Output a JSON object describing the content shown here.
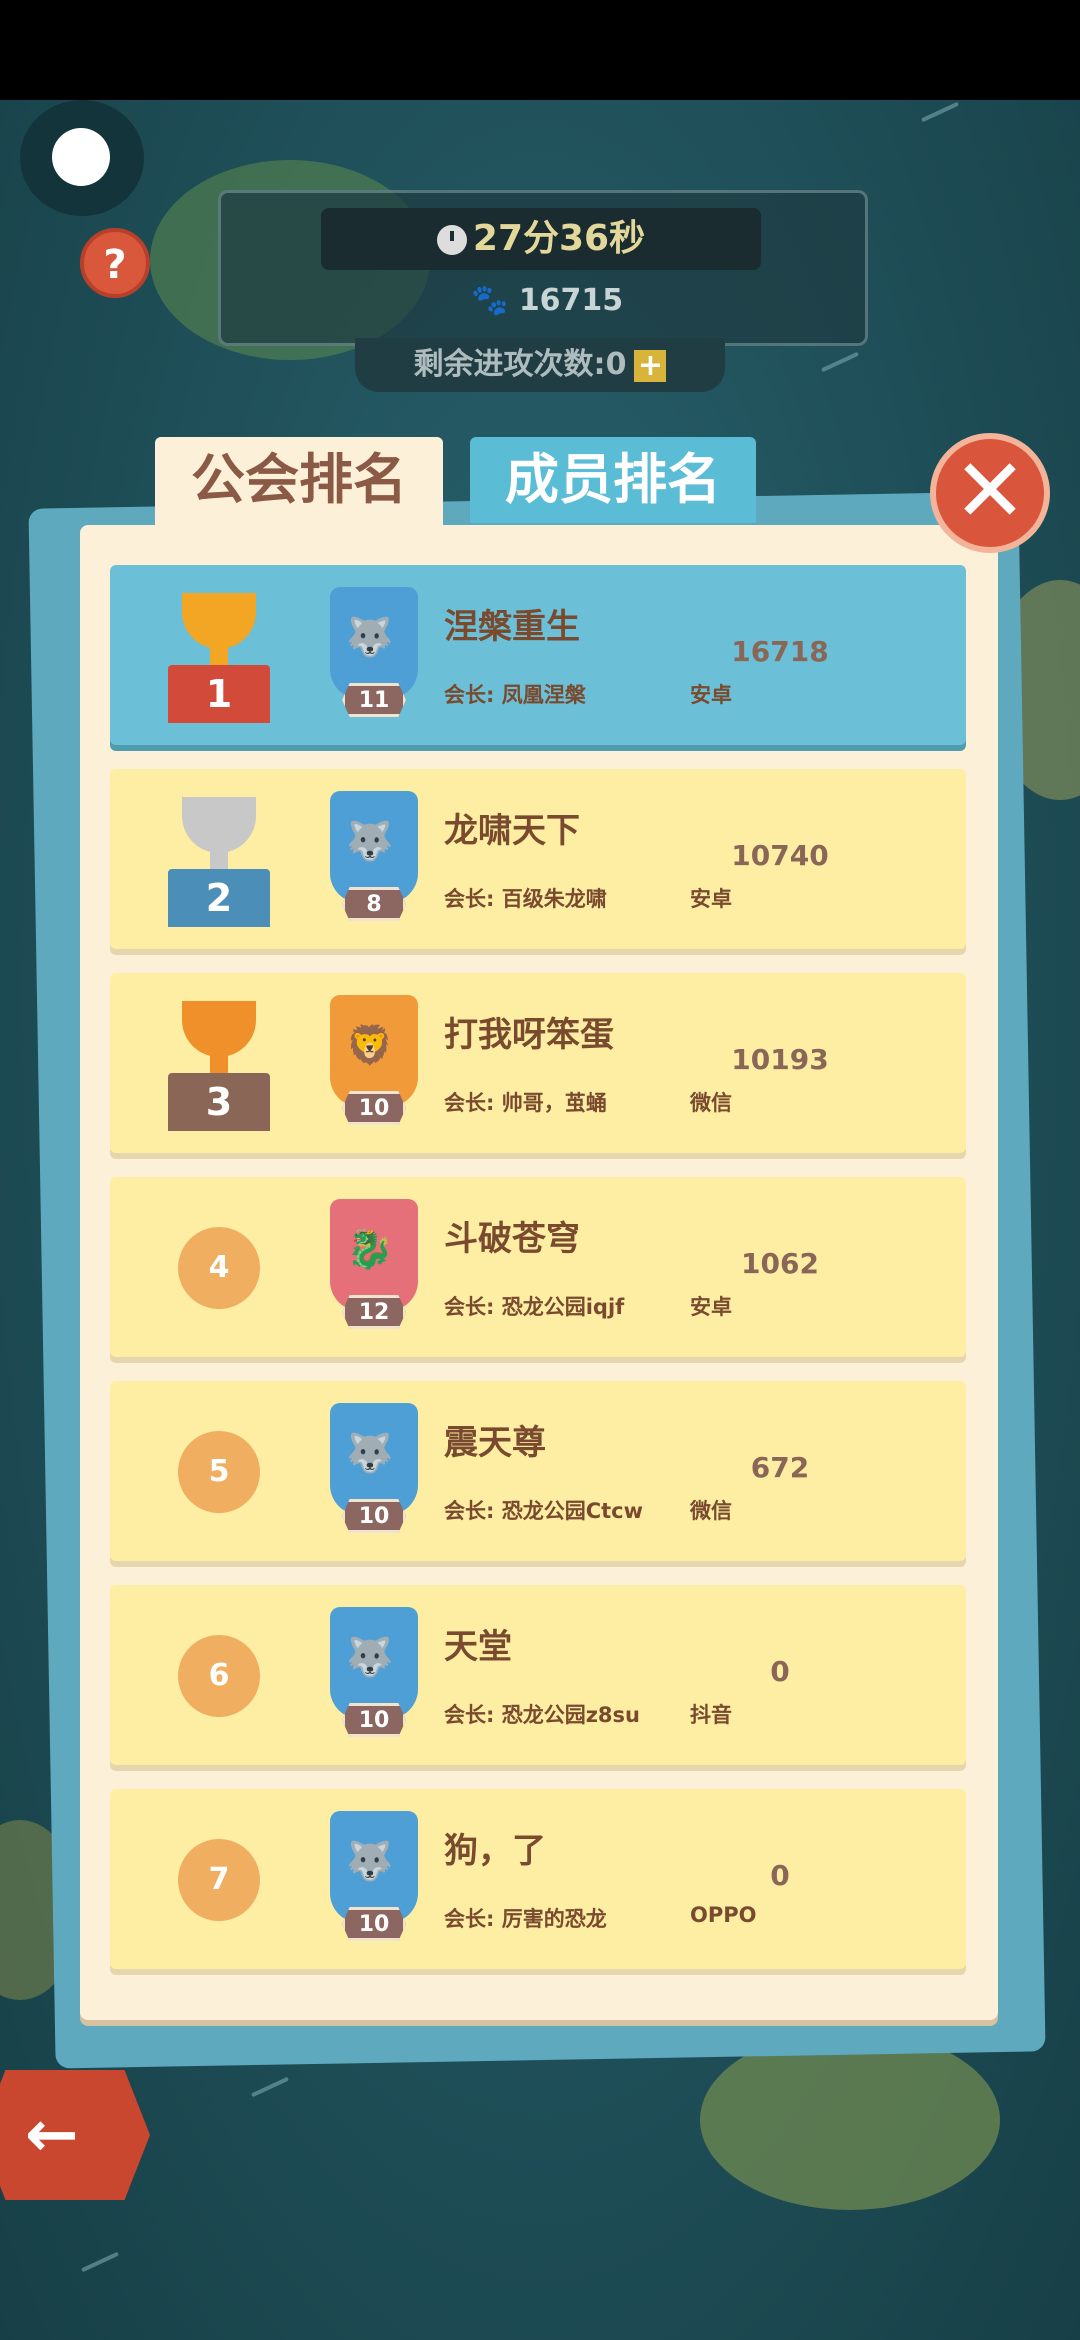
{
  "hud": {
    "timer": "27分36秒",
    "power": "16715",
    "attack_label": "剩余进攻次数:",
    "attack_count": "0",
    "plus": "+",
    "help": "?"
  },
  "tabs": {
    "guild_ranking": "公会排名",
    "member_ranking": "成员排名"
  },
  "close": "✕",
  "back": "←",
  "leader_prefix": "会长:",
  "rows": [
    {
      "rank": "1",
      "name": "涅槃重生",
      "leader": "会长: 凤凰涅槃",
      "platform": "安卓",
      "score": "16718",
      "level": "11",
      "emblem": "wolf",
      "color": "#4d9fd6"
    },
    {
      "rank": "2",
      "name": "龙啸天下",
      "leader": "会长: 百级朱龙啸",
      "platform": "安卓",
      "score": "10740",
      "level": "8",
      "emblem": "wolf",
      "color": "#4d9fd6"
    },
    {
      "rank": "3",
      "name": "打我呀笨蛋",
      "leader": "会长: 帅哥，茧蛹",
      "platform": "微信",
      "score": "10193",
      "level": "10",
      "emblem": "lion",
      "color": "#f09a3a"
    },
    {
      "rank": "4",
      "name": "斗破苍穹",
      "leader": "会长: 恐龙公园iqjf",
      "platform": "安卓",
      "score": "1062",
      "level": "12",
      "emblem": "dragon",
      "color": "#e5707a"
    },
    {
      "rank": "5",
      "name": "震天尊",
      "leader": "会长: 恐龙公园Ctcw",
      "platform": "微信",
      "score": "672",
      "level": "10",
      "emblem": "wolf",
      "color": "#4d9fd6"
    },
    {
      "rank": "6",
      "name": "天堂",
      "leader": "会长: 恐龙公园z8su",
      "platform": "抖音",
      "score": "0",
      "level": "10",
      "emblem": "wolf",
      "color": "#4d9fd6"
    },
    {
      "rank": "7",
      "name": "狗，了",
      "leader": "会长: 厉害的恐龙",
      "platform": "OPPO",
      "score": "0",
      "level": "10",
      "emblem": "wolf",
      "color": "#4d9fd6"
    }
  ]
}
